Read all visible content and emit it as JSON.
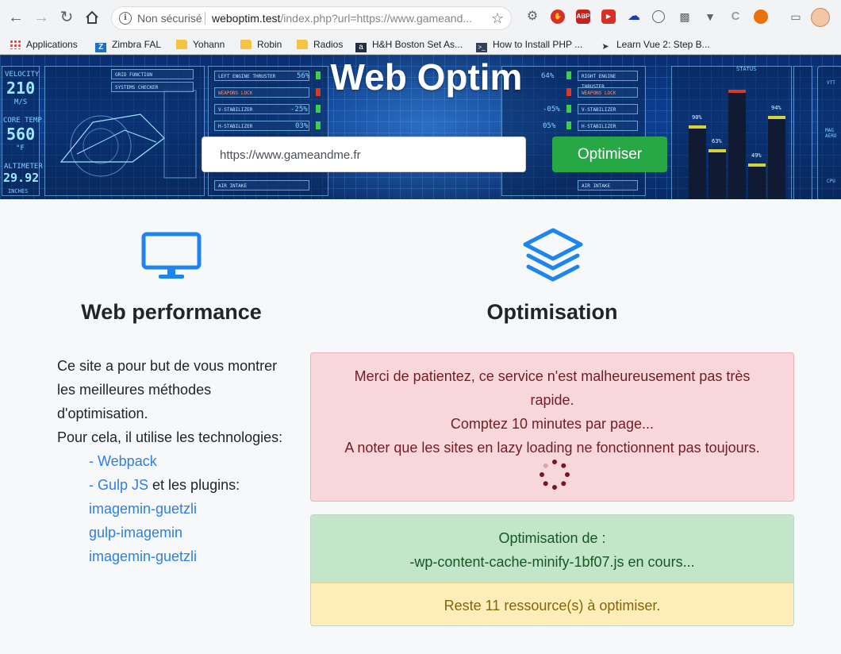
{
  "browser": {
    "insecure_label": "Non sécurisé",
    "url_host": "weboptim.test",
    "url_path": "/index.php?url=https://www.gameand...",
    "extensions": [
      "gear",
      "stop",
      "ABP",
      "record",
      "cloud",
      "circle",
      "folder",
      "vue",
      "c",
      "fire",
      "cast"
    ]
  },
  "bookmarks": [
    {
      "label": "Applications",
      "icon": "apps-grid-icon"
    },
    {
      "label": "Zimbra FAL",
      "icon": "zimbra-icon"
    },
    {
      "label": "Yohann",
      "icon": "folder-icon"
    },
    {
      "label": "Robin",
      "icon": "folder-icon"
    },
    {
      "label": "Radios",
      "icon": "folder-icon"
    },
    {
      "label": "H&H Boston Set As...",
      "icon": "amazon-icon"
    },
    {
      "label": "How to Install PHP ...",
      "icon": "terminal-icon"
    },
    {
      "label": "Learn Vue 2: Step B...",
      "icon": "vue-icon"
    }
  ],
  "hero": {
    "title": "Web Optim",
    "url_value": "https://www.gameandme.fr",
    "submit_label": "Optimiser",
    "hud": {
      "velocity_label": "VELOCITY",
      "velocity_value": "210",
      "velocity_unit": "M/S",
      "core_label": "CORE TEMP",
      "core_value": "560",
      "core_unit": "°F",
      "alt_label": "ALTIMETER",
      "alt_value": "29.92",
      "alt_unit": "INCHES",
      "grid_function": "GRID FUNCTION",
      "systems_checker": "SYSTEMS CHECKER",
      "left_rows": [
        "LEFT ENGINE THRUSTER",
        "WEAPONS LOCK",
        "V-STABILIZER",
        "H-STABILIZER",
        "AIR INTAKE"
      ],
      "left_vals": [
        "56%",
        "",
        "-25%",
        "03%",
        ""
      ],
      "right_rows": [
        "RIGHT ENGINE THRUSTER",
        "WEAPONS LOCK",
        "V-STABILIZER",
        "H-STABILIZER",
        "AIR INTAKE"
      ],
      "right_vals": [
        "64%",
        "",
        "-05%",
        "05%",
        ""
      ],
      "status_label": "STATUS",
      "bars": [
        {
          "label": "90%",
          "level": 0.62
        },
        {
          "label": "63%",
          "level": 0.42
        },
        {
          "label": "",
          "level": 0.92,
          "red": true
        },
        {
          "label": "49%",
          "level": 0.3
        },
        {
          "label": "94%",
          "level": 0.7
        }
      ],
      "right_labels": [
        "VTT",
        "MAG AERO",
        "CPU"
      ]
    }
  },
  "features": {
    "left_title": "Web performance",
    "right_title": "Optimisation"
  },
  "description": {
    "line1": "Ce site a pour but de vous montrer les meilleures méthodes d'optimisation.",
    "line2": "Pour cela, il utilise les technologies:",
    "webpack": "- Webpack",
    "gulp": "- Gulp JS",
    "gulp_suffix": " et les plugins:",
    "plugins": [
      "imagemin-guetzli",
      "gulp-imagemin",
      "imagemin-guetzli"
    ]
  },
  "alert": {
    "line1": "Merci de patientez, ce service n'est malheureusement pas très rapide.",
    "line2": "Comptez 10 minutes par page...",
    "line3": "A noter que les sites en lazy loading ne fonctionnent pas toujours."
  },
  "status": {
    "title": "Optimisation de :",
    "file": "-wp-content-cache-minify-1bf07.js en cours...",
    "remaining": "Reste 11 ressource(s) à optimiser."
  },
  "colors": {
    "success": "#28a745",
    "link": "#2d7fe0",
    "icon_blue": "#1d84f0"
  }
}
